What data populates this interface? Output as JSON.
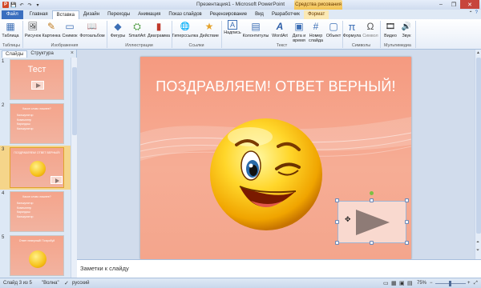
{
  "window": {
    "title": "Презентация1 - Microsoft PowerPoint",
    "context_tab_header": "Средства рисования",
    "minimize": "–",
    "maximize": "❐",
    "close": "✕"
  },
  "tabs": [
    {
      "label": "Файл"
    },
    {
      "label": "Главная"
    },
    {
      "label": "Вставка"
    },
    {
      "label": "Дизайн"
    },
    {
      "label": "Переходы"
    },
    {
      "label": "Анимация"
    },
    {
      "label": "Показ слайдов"
    },
    {
      "label": "Рецензирование"
    },
    {
      "label": "Вид"
    },
    {
      "label": "Разработчик"
    },
    {
      "label": "Формат"
    }
  ],
  "ribbon": {
    "buttons": [
      {
        "label": "Таблица",
        "icon": "table-icon",
        "glyph": "▦"
      },
      {
        "label": "Рисунок",
        "icon": "picture-icon",
        "glyph": "🖼"
      },
      {
        "label": "Картинка",
        "icon": "clipart-icon",
        "glyph": "✎"
      },
      {
        "label": "Снимок",
        "icon": "screenshot-icon",
        "glyph": "▭"
      },
      {
        "label": "Фотоальбом",
        "icon": "photo-album-icon",
        "glyph": "📖"
      },
      {
        "label": "Фигуры",
        "icon": "shapes-icon",
        "glyph": "◆"
      },
      {
        "label": "SmartArt",
        "icon": "smartart-icon",
        "glyph": "⛭"
      },
      {
        "label": "Диаграмма",
        "icon": "chart-icon",
        "glyph": "▮"
      },
      {
        "label": "Гиперссылка",
        "icon": "hyperlink-icon",
        "glyph": "🌐"
      },
      {
        "label": "Действие",
        "icon": "action-icon",
        "glyph": "★"
      },
      {
        "label": "Надпись",
        "icon": "textbox-icon",
        "glyph": "A"
      },
      {
        "label": "Колонтитулы",
        "icon": "header-footer-icon",
        "glyph": "▤"
      },
      {
        "label": "WordArt",
        "icon": "wordart-icon",
        "glyph": "A"
      },
      {
        "label": "Дата и время",
        "icon": "date-time-icon",
        "glyph": "▣"
      },
      {
        "label": "Номер слайда",
        "icon": "slide-number-icon",
        "glyph": "#"
      },
      {
        "label": "Объект",
        "icon": "object-icon",
        "glyph": "▢"
      },
      {
        "label": "Формула",
        "icon": "equation-icon",
        "glyph": "π"
      },
      {
        "label": "Символ",
        "icon": "symbol-icon",
        "glyph": "Ω"
      },
      {
        "label": "Видео",
        "icon": "video-icon",
        "glyph": "🎞"
      },
      {
        "label": "Звук",
        "icon": "audio-icon",
        "glyph": "🔊"
      }
    ],
    "groups": [
      {
        "label": "Таблицы"
      },
      {
        "label": "Изображения"
      },
      {
        "label": "Иллюстрации"
      },
      {
        "label": "Ссылки"
      },
      {
        "label": "Текст"
      },
      {
        "label": "Символы"
      },
      {
        "label": "Мультимедиа"
      }
    ]
  },
  "left_panel": {
    "tabs": [
      {
        "label": "Слайды"
      },
      {
        "label": "Структура"
      }
    ],
    "close": "×",
    "slides": [
      {
        "number": "1",
        "title": "Тест",
        "kind": "title"
      },
      {
        "number": "2",
        "title": "Какое слово лишнее?",
        "kind": "question",
        "options": [
          "Калькулятор",
          "Компьютер",
          "Карандаш",
          "Калькулятор"
        ]
      },
      {
        "number": "3",
        "title": "Поздравляем! Ответ верный!",
        "kind": "result",
        "selected": true
      },
      {
        "number": "4",
        "title": "Какое слово лишнее?",
        "kind": "question",
        "options": [
          "Калькулятор",
          "Компьютер",
          "Карандаш",
          "Калькулятор"
        ]
      },
      {
        "number": "5",
        "title": "Ответ неверный! Попробуй",
        "kind": "sad"
      }
    ]
  },
  "main_slide": {
    "title": "ПОЗДРАВЛЯЕМ! ОТВЕТ ВЕРНЫЙ!"
  },
  "notes": {
    "placeholder": "Заметки к слайду"
  },
  "status": {
    "slide_info": "Слайд 3 из 5",
    "theme": "\"Волна\"",
    "language": "русский",
    "zoom": "75%"
  },
  "colors": {
    "slide_bg": "#f59a80",
    "selected_thumb": "#f5d58a",
    "file_tab": "#3a6fbf"
  }
}
